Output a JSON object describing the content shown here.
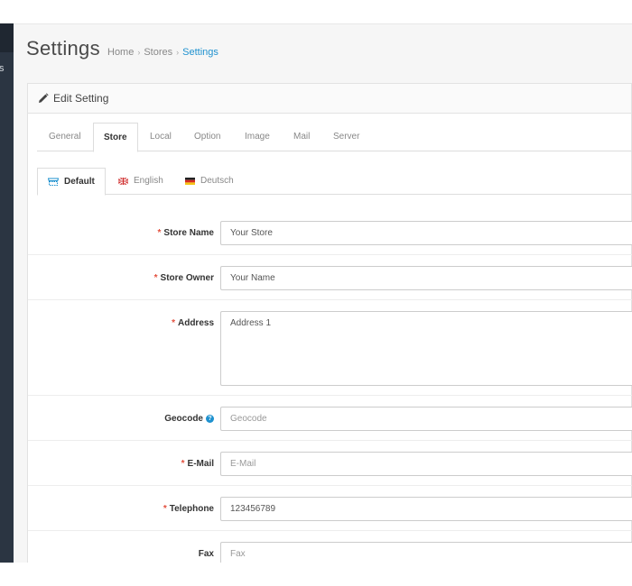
{
  "sidebar": {
    "fragment_text": "s"
  },
  "header": {
    "title": "Settings",
    "breadcrumb": [
      {
        "label": "Home"
      },
      {
        "label": "Stores"
      },
      {
        "label": "Settings"
      }
    ]
  },
  "panel": {
    "title": "Edit Setting",
    "title_icon": "pencil-icon"
  },
  "tabs": [
    {
      "label": "General"
    },
    {
      "label": "Store"
    },
    {
      "label": "Local"
    },
    {
      "label": "Option"
    },
    {
      "label": "Image"
    },
    {
      "label": "Mail"
    },
    {
      "label": "Server"
    }
  ],
  "active_tab": "Store",
  "language_tabs": [
    {
      "label": "Default",
      "icon": "store-icon"
    },
    {
      "label": "English",
      "icon": "uk-flag-icon"
    },
    {
      "label": "Deutsch",
      "icon": "germany-flag-icon"
    }
  ],
  "form": {
    "store_name": {
      "label": "Store Name",
      "required": "*",
      "value": "Your Store"
    },
    "store_owner": {
      "label": "Store Owner",
      "required": "*",
      "value": "Your Name"
    },
    "address": {
      "label": "Address",
      "required": "*",
      "value": "Address 1"
    },
    "geocode": {
      "label": "Geocode",
      "help": "?",
      "placeholder": "Geocode"
    },
    "email": {
      "label": "E-Mail",
      "required": "*",
      "placeholder": "E-Mail"
    },
    "telephone": {
      "label": "Telephone",
      "required": "*",
      "value": "123456789"
    },
    "fax": {
      "label": "Fax",
      "placeholder": "Fax"
    }
  },
  "colors": {
    "accent": "#1e91cf",
    "required": "#e3503e",
    "sidebar": "#2b3542"
  }
}
